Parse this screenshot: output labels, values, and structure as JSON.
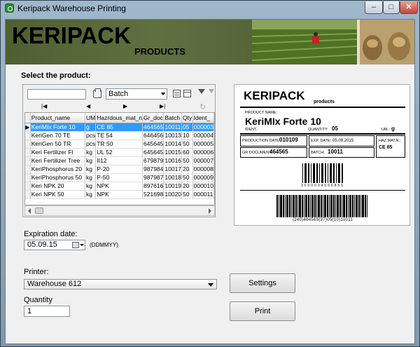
{
  "window": {
    "title": "Keripack Warehouse Printing",
    "minimize": "–",
    "maximize": "□",
    "close": "✕"
  },
  "banner": {
    "logo_main": "KERIPACK",
    "logo_sub": "PRODUCTS"
  },
  "product_section": {
    "label": "Select the product:",
    "search_value": "",
    "group_by_value": "Batch",
    "nav": {
      "first": "|◀",
      "prev": "◀",
      "next": "▶",
      "last": "▶|",
      "refresh": "↻"
    },
    "columns": [
      "Product_name",
      "UM",
      "Hazrdous_mat_n",
      "Gr_doc",
      "Batch",
      "Qty",
      "Ident_"
    ],
    "rows": [
      {
        "indicator": "▶",
        "cells": [
          "KeriMIx Forte 10",
          "g",
          "CE 85",
          "464565",
          "10011",
          "05",
          "000003"
        ],
        "selected": true
      },
      {
        "indicator": "",
        "cells": [
          "KeriGen 70 TE",
          "pcs",
          "TE 54",
          "646456",
          "10013",
          "10",
          "000004"
        ],
        "selected": false
      },
      {
        "indicator": "",
        "cells": [
          "KeriGen 50 TR",
          "pcs",
          "TR 50",
          "645645",
          "10014",
          "50",
          "000005"
        ],
        "selected": false
      },
      {
        "indicator": "",
        "cells": [
          "Keri Fertilizer Fl",
          "kg",
          "UL 52",
          "645645",
          "10015",
          "60",
          "000006"
        ],
        "selected": false
      },
      {
        "indicator": "",
        "cells": [
          "Keri Fertilizer Tree",
          "kg",
          "II12",
          "679879",
          "10016",
          "50",
          "000007"
        ],
        "selected": false
      },
      {
        "indicator": "",
        "cells": [
          "KeriPhosphorus 20",
          "kg",
          "P-20",
          "987984",
          "10017",
          "20",
          "000008"
        ],
        "selected": false
      },
      {
        "indicator": "",
        "cells": [
          "KeriPhosphorus 50",
          "kg",
          "P-50",
          "987987",
          "10018",
          "50",
          "000009"
        ],
        "selected": false
      },
      {
        "indicator": "",
        "cells": [
          "Keri NPK 20",
          "kg",
          "NPK",
          "897616",
          "10019",
          "20",
          "000010"
        ],
        "selected": false
      },
      {
        "indicator": "",
        "cells": [
          "Keri NPK 50",
          "kg",
          "NPK",
          "521698",
          "10020",
          "50",
          "000011"
        ],
        "selected": false
      }
    ]
  },
  "label_preview": {
    "logo_main": "KERIPACK",
    "logo_sub": "products",
    "product_name_label": "PRODUCT NAME:",
    "product_name": "KeriMIx Forte 10",
    "ident_label": "IDENT.:",
    "quantity_label": "QUANTITY:",
    "quantity": "05",
    "um_label": "UM.:",
    "um": "g",
    "production_date_label": "PRODUCTION DATE:",
    "production_date": "010109",
    "exp_date_label": "EXP. DATE:",
    "exp_date": "05.09.2015",
    "haz_mat_label": "HAZ.MAT.N.:",
    "haz_mat": "CE 85",
    "gr_document_label": "GR DOCUMENT:",
    "gr_document": "464565",
    "batch_label": "BATCH:",
    "batch": "10011",
    "barcode1_text": "3 0 0 0 0 0 4 0 6 6 8 5 5",
    "barcode2_text": "(240)464565(37)05(10)10011"
  },
  "expiration": {
    "label": "Expiration date:",
    "value": "05.09.15",
    "format_hint": "(DDMMYY)"
  },
  "printer": {
    "label": "Printer:",
    "value": "Warehouse 612"
  },
  "quantity": {
    "label": "Quantity",
    "value": "1"
  },
  "buttons": {
    "settings": "Settings",
    "print": "Print"
  }
}
